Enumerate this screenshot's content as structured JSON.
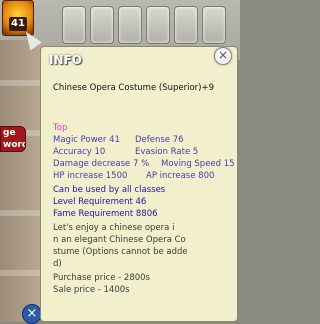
{
  "hud": {
    "level_badge": "41",
    "side_button_label": "ge\nword",
    "bottom_close_label": "×"
  },
  "tooltip": {
    "title": "INFO",
    "close_label": "×",
    "item_name": "Chinese Opera Costume (Superior)+9",
    "slot": "Top",
    "stats": [
      {
        "left": "Magic Power 41",
        "right": "Defense 76"
      },
      {
        "left": "Accuracy 10",
        "right": "Evasion Rate 5"
      },
      {
        "left": "Damage decrease 7 %",
        "right": "Moving Speed 15"
      },
      {
        "left": "HP increase 1500",
        "right": "AP increase 800"
      }
    ],
    "class_req": "Can be used by all classes",
    "level_req": "Level Requirement 46",
    "fame_req": "Fame Requirement 8806",
    "description": [
      "Let's enjoy a chinese opera i",
      "n an elegant Chinese Opera Co",
      "stume (Options cannot be adde",
      "d)"
    ],
    "purchase_price": "Purchase price - 2800s",
    "sale_price": "Sale price - 1400s"
  }
}
